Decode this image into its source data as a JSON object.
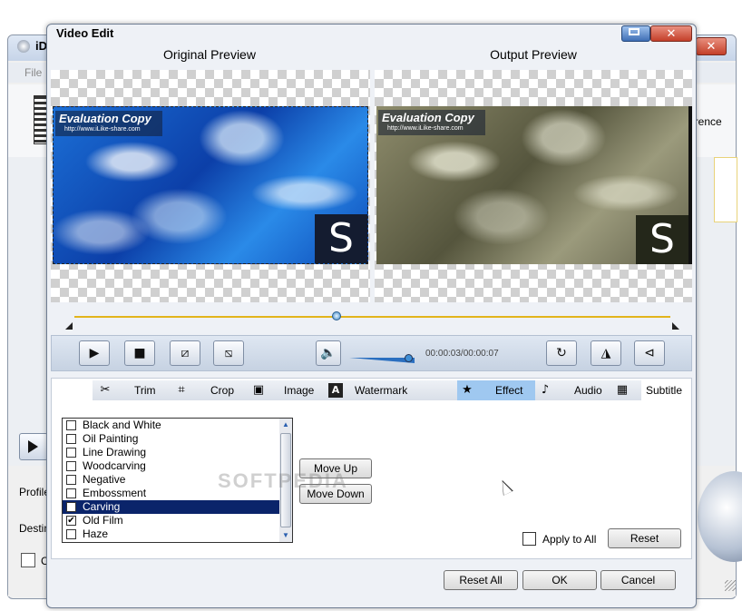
{
  "background_app": {
    "title": "iD",
    "menu_file": "File",
    "preference_label": "erence",
    "profile_label": "Profile",
    "destination_label": "Destin",
    "check_label": "C"
  },
  "dialog": {
    "title": "Video Edit",
    "restore_icon": "restore-icon",
    "close_glyph": "✕"
  },
  "preview": {
    "original_label": "Original Preview",
    "output_label": "Output Preview",
    "eval_title": "Evaluation Copy",
    "eval_url": "http://www.iLike-share.com",
    "logo_letter": "S"
  },
  "controls": {
    "time": "00:00:03/00:00:07",
    "timeline_position": 0.44,
    "volume_level": 0.9
  },
  "tabs": [
    {
      "label": "Trim",
      "icon": "scissors-icon",
      "glyph": "✂"
    },
    {
      "label": "Crop",
      "icon": "crop-icon",
      "glyph": "⌗"
    },
    {
      "label": "Image",
      "icon": "image-icon",
      "glyph": "▣"
    },
    {
      "label": "Watermark",
      "icon": "watermark-icon",
      "glyph": "A"
    },
    {
      "label": "Effect",
      "icon": "star-icon",
      "glyph": "★"
    },
    {
      "label": "Audio",
      "icon": "music-note-icon",
      "glyph": "♪"
    },
    {
      "label": "Subtitle",
      "icon": "subtitle-icon",
      "glyph": "▦"
    }
  ],
  "active_tab": "Effect",
  "effects": [
    {
      "label": "Black and White",
      "checked": false,
      "selected": false
    },
    {
      "label": "Oil Painting",
      "checked": false,
      "selected": false
    },
    {
      "label": "Line Drawing",
      "checked": false,
      "selected": false
    },
    {
      "label": "Woodcarving",
      "checked": false,
      "selected": false
    },
    {
      "label": "Negative",
      "checked": false,
      "selected": false
    },
    {
      "label": "Embossment",
      "checked": false,
      "selected": false
    },
    {
      "label": "Carving",
      "checked": false,
      "selected": true
    },
    {
      "label": "Old Film",
      "checked": true,
      "selected": false
    },
    {
      "label": "Haze",
      "checked": false,
      "selected": false
    }
  ],
  "buttons": {
    "move_up": "Move Up",
    "move_down": "Move Down",
    "apply_to_all": "Apply to All",
    "reset": "Reset",
    "reset_all": "Reset All",
    "ok": "OK",
    "cancel": "Cancel"
  },
  "watermark_text": "SOFTPEDIA"
}
